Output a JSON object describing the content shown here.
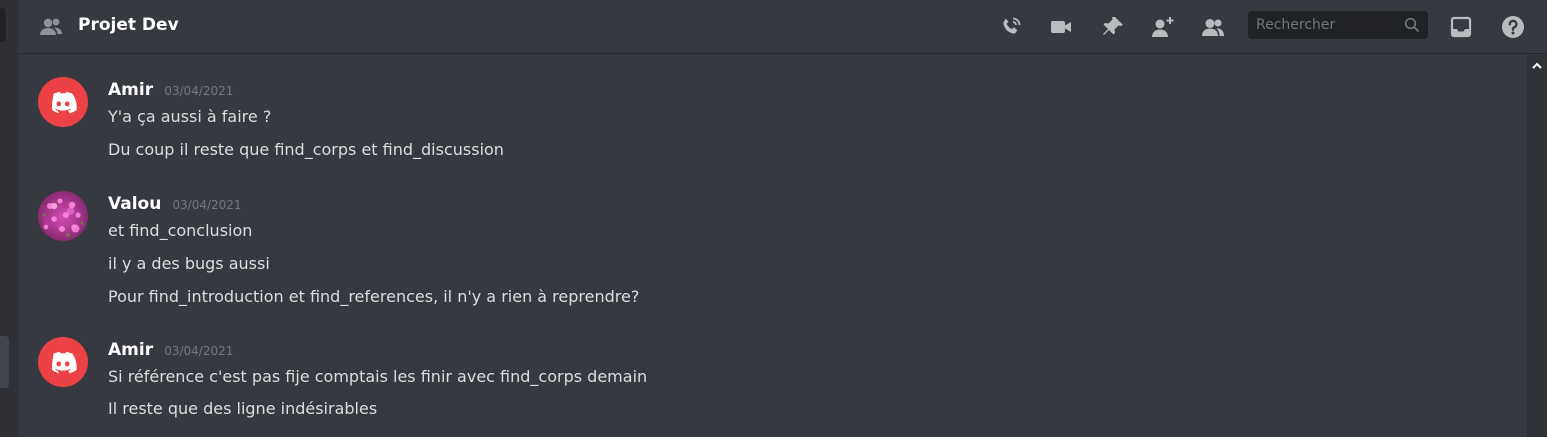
{
  "header": {
    "channel_name": "Projet Dev",
    "search_placeholder": "Rechercher",
    "icons": [
      "phone-call-icon",
      "video-icon",
      "pin-icon",
      "add-member-icon",
      "members-icon",
      "search-icon",
      "inbox-icon",
      "help-icon"
    ]
  },
  "colors": {
    "background": "#36393f",
    "header_text": "#ffffff",
    "message_text": "#dcddde",
    "timestamp": "#72767d",
    "discord_red": "#ed4245",
    "search_bg": "#202225"
  },
  "messages": [
    {
      "author": "Amir",
      "timestamp": "03/04/2021",
      "avatar": "discord-logo-avatar",
      "lines": [
        "Y'a ça aussi à faire ?",
        "Du coup il reste que find_corps et find_discussion"
      ]
    },
    {
      "author": "Valou",
      "timestamp": "03/04/2021",
      "avatar": "flower-photo-avatar",
      "lines": [
        "et find_conclusion",
        "il y a des bugs aussi",
        "Pour find_introduction et find_references, il n'y a rien à reprendre?"
      ]
    },
    {
      "author": "Amir",
      "timestamp": "03/04/2021",
      "avatar": "discord-logo-avatar",
      "lines": [
        "Si référence c'est pas fije comptais les finir avec find_corps demain",
        "Il reste que des ligne indésirables"
      ]
    }
  ]
}
